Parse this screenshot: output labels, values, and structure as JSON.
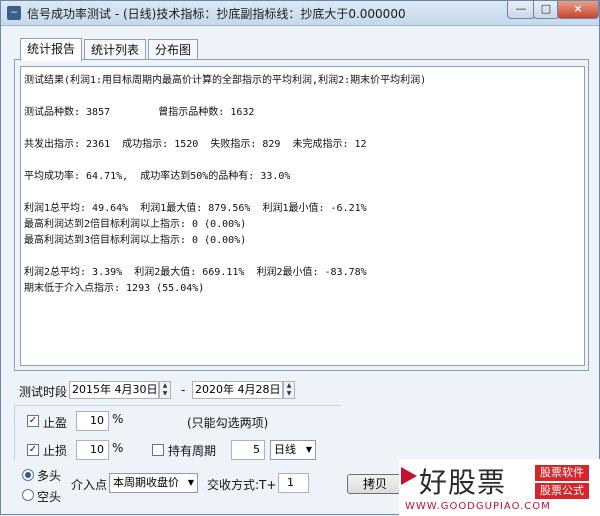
{
  "window": {
    "title": "信号成功率测试 - (日线)技术指标：抄底副指标线：抄底大于0.000000",
    "icon": "chart-app-icon",
    "controls": {
      "minimize": "—",
      "maximize": "□",
      "close": "×"
    }
  },
  "tabs": [
    {
      "label": "统计报告",
      "active": true
    },
    {
      "label": "统计列表",
      "active": false
    },
    {
      "label": "分布图",
      "active": false
    }
  ],
  "report": {
    "lines": [
      "测试结果(利润1:用目标周期内最高价计算的全部指示的平均利润,利润2:期末价平均利润)",
      "",
      "测试品种数: 3857        曾指示品种数: 1632",
      "",
      "共发出指示: 2361  成功指示: 1520  失败指示: 829  未完成指示: 12",
      "",
      "平均成功率: 64.71%,  成功率达到50%的品种有: 33.0%",
      "",
      "利润1总平均: 49.64%  利润1最大值: 879.56%  利润1最小值: -6.21%",
      "最高利润达到2倍目标利润以上指示: 0 (0.00%)",
      "最高利润达到3倍目标利润以上指示: 0 (0.00%)",
      "",
      "利润2总平均: 3.39%  利润2最大值: 669.11%  利润2最小值: -83.78%",
      "期末低于介入点指示: 1293 (55.04%)"
    ]
  },
  "period": {
    "label": "测试时段",
    "start": {
      "year": "2015年",
      "date": "4月30日"
    },
    "separator": "-",
    "end": {
      "year": "2020年",
      "date": "4月28日"
    }
  },
  "options": {
    "take_profit": {
      "label": "止盈",
      "checked": true,
      "value": "10",
      "unit": "%"
    },
    "stop_loss": {
      "label": "止损",
      "checked": true,
      "value": "10",
      "unit": "%"
    },
    "note": "(只能勾选两项)",
    "hold_period": {
      "label": "持有周期",
      "checked": false,
      "value": "5",
      "unit_select": "日线"
    }
  },
  "direction": {
    "long": {
      "label": "多头",
      "selected": true
    },
    "short": {
      "label": "空头",
      "selected": false
    }
  },
  "entry": {
    "label": "介入点",
    "select": "本周期收盘价",
    "trade_label": "交收方式:T+",
    "trade_value": "1"
  },
  "buttons": {
    "copy": "拷贝"
  },
  "watermark": {
    "brand": "好股票",
    "url": "WWW.GOODGUPIAO.COM",
    "tag1": "股票软件",
    "tag2": "股票公式"
  }
}
